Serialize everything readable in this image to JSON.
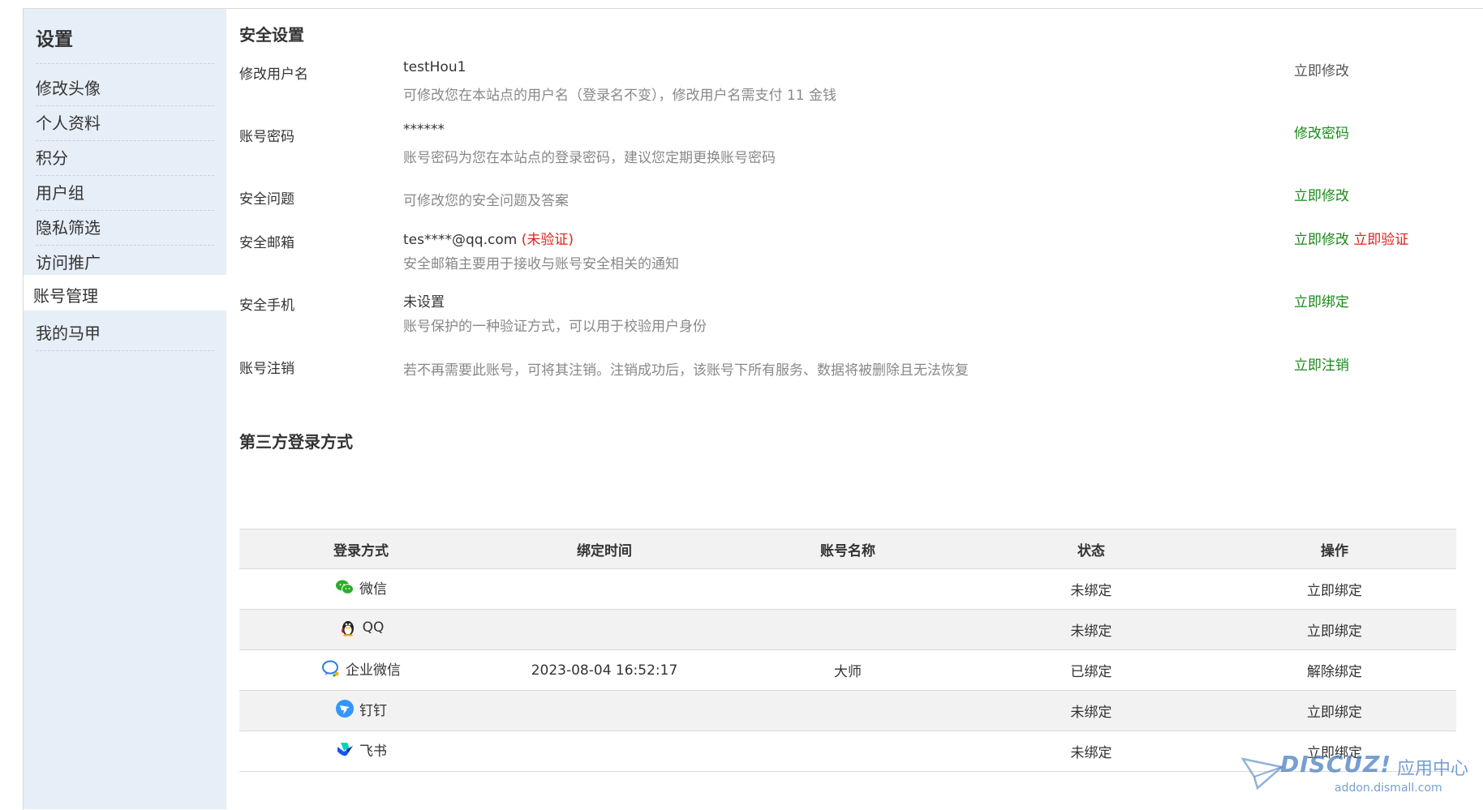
{
  "sidebar": {
    "title": "设置",
    "items": [
      {
        "label": "修改头像",
        "active": false
      },
      {
        "label": "个人资料",
        "active": false
      },
      {
        "label": "积分",
        "active": false
      },
      {
        "label": "用户组",
        "active": false
      },
      {
        "label": "隐私筛选",
        "active": false
      },
      {
        "label": "访问推广",
        "active": false
      },
      {
        "label": "账号管理",
        "active": true
      },
      {
        "label": "我的马甲",
        "active": false
      }
    ]
  },
  "security": {
    "title": "安全设置",
    "username": {
      "label": "修改用户名",
      "value": "testHou1",
      "desc": "可修改您在本站点的用户名（登录名不变），修改用户名需支付 11 金钱",
      "action": "立即修改"
    },
    "password": {
      "label": "账号密码",
      "value": "******",
      "desc": "账号密码为您在本站点的登录密码，建议您定期更换账号密码",
      "action": "修改密码"
    },
    "question": {
      "label": "安全问题",
      "desc": "可修改您的安全问题及答案",
      "action": "立即修改"
    },
    "email": {
      "label": "安全邮箱",
      "value": "tes****@qq.com",
      "status": "(未验证)",
      "desc": "安全邮箱主要用于接收与账号安全相关的通知",
      "action": "立即修改",
      "action2": "立即验证"
    },
    "phone": {
      "label": "安全手机",
      "value": "未设置",
      "desc": "账号保护的一种验证方式，可以用于校验用户身份",
      "action": "立即绑定"
    },
    "cancel": {
      "label": "账号注销",
      "desc": "若不再需要此账号，可将其注销。注销成功后，该账号下所有服务、数据将被删除且无法恢复",
      "action": "立即注销"
    }
  },
  "third_party": {
    "title": "第三方登录方式",
    "headers": [
      "登录方式",
      "绑定时间",
      "账号名称",
      "状态",
      "操作"
    ],
    "rows": [
      {
        "icon": "wechat-icon",
        "method": "微信",
        "time": "",
        "account": "",
        "status": "未绑定",
        "action": "立即绑定"
      },
      {
        "icon": "qq-icon",
        "method": "QQ",
        "time": "",
        "account": "",
        "status": "未绑定",
        "action": "立即绑定"
      },
      {
        "icon": "wework-icon",
        "method": "企业微信",
        "time": "2023-08-04 16:52:17",
        "account": "大师",
        "status": "已绑定",
        "action": "解除绑定"
      },
      {
        "icon": "dingtalk-icon",
        "method": "钉钉",
        "time": "",
        "account": "",
        "status": "未绑定",
        "action": "立即绑定"
      },
      {
        "icon": "feishu-icon",
        "method": "飞书",
        "time": "",
        "account": "",
        "status": "未绑定",
        "action": "立即绑定"
      }
    ]
  },
  "watermark": {
    "brand": "DISCUZ!",
    "cn": "应用中心",
    "url": "addon.dismall.com"
  },
  "colors": {
    "sidebar_bg": "#e6eef7",
    "green": "#1a8a1a",
    "red": "#e02020",
    "gray_text": "#888888",
    "table_alt_bg": "#f2f2f2"
  }
}
